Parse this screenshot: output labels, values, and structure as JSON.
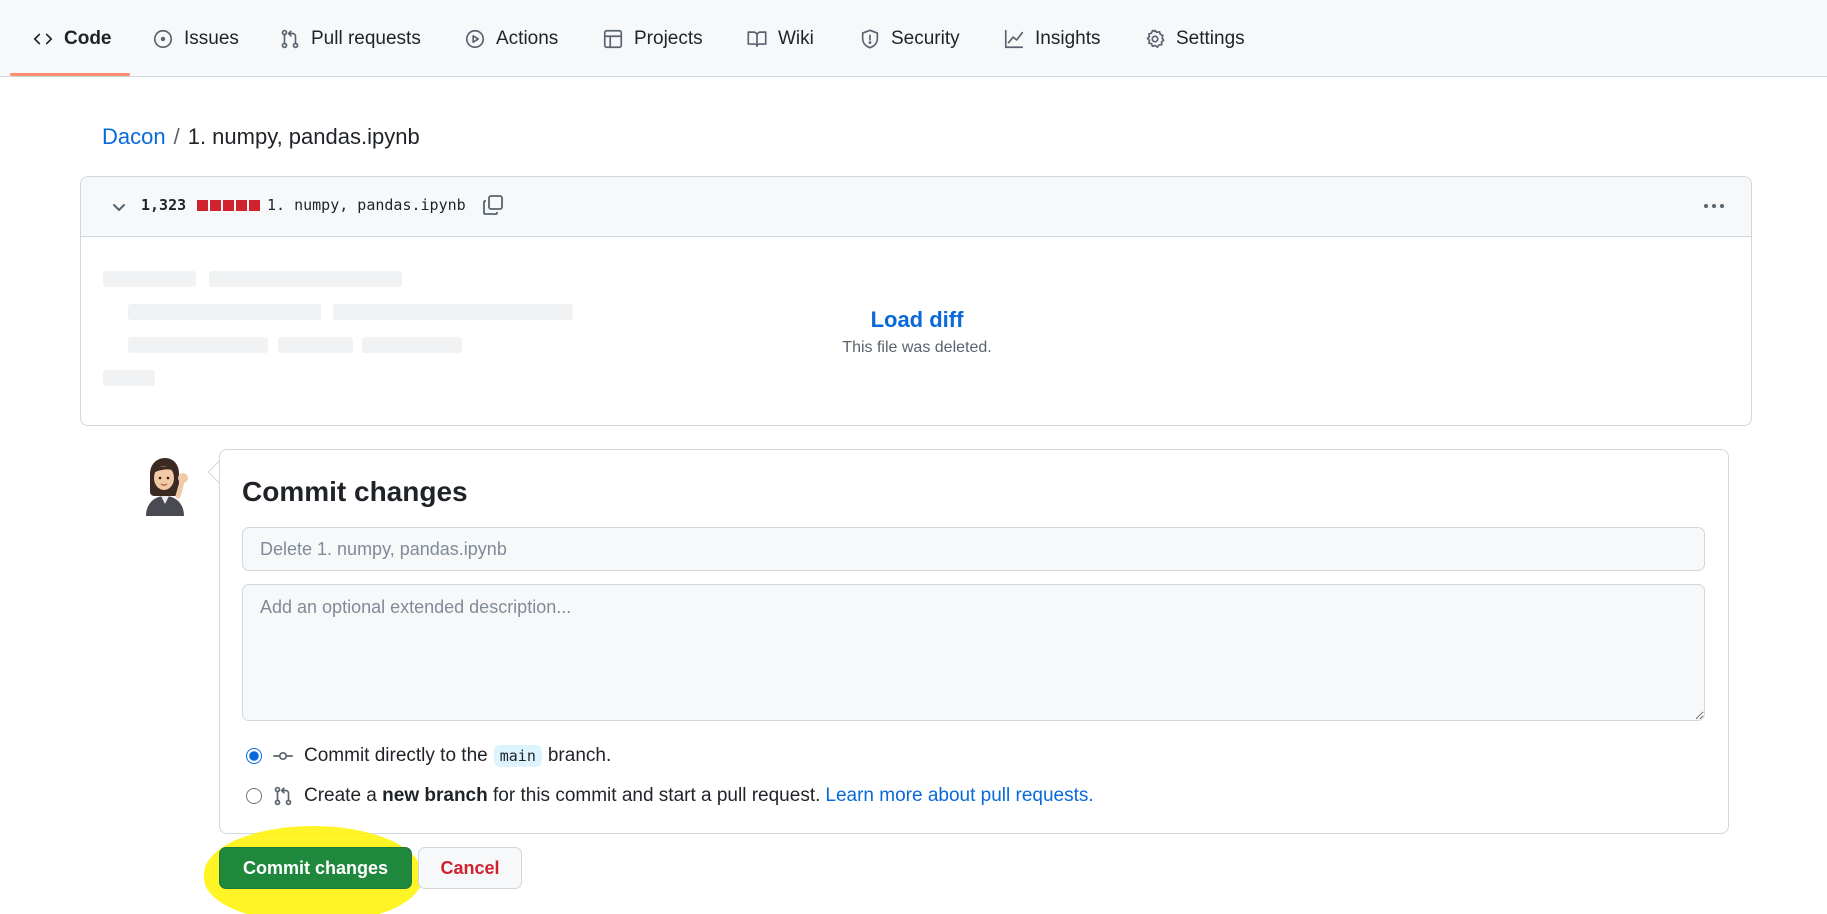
{
  "nav": {
    "tabs": [
      {
        "label": "Code",
        "icon": "code-icon",
        "active": true
      },
      {
        "label": "Issues",
        "icon": "issue-opened-icon"
      },
      {
        "label": "Pull requests",
        "icon": "git-pull-request-icon"
      },
      {
        "label": "Actions",
        "icon": "play-icon"
      },
      {
        "label": "Projects",
        "icon": "table-icon"
      },
      {
        "label": "Wiki",
        "icon": "book-icon"
      },
      {
        "label": "Security",
        "icon": "shield-icon"
      },
      {
        "label": "Insights",
        "icon": "graph-icon"
      },
      {
        "label": "Settings",
        "icon": "gear-icon"
      }
    ]
  },
  "breadcrumb": {
    "repo": "Dacon",
    "separator": "/",
    "file": "1. numpy, pandas.ipynb"
  },
  "diff": {
    "deletions": "1,323",
    "filename": "1. numpy, pandas.ipynb",
    "load_label": "Load diff",
    "status_text": "This file was deleted."
  },
  "commit": {
    "title": "Commit changes",
    "summary_placeholder": "Delete 1. numpy, pandas.ipynb",
    "description_placeholder": "Add an optional extended description...",
    "option_direct": {
      "prefix": "Commit directly to the",
      "branch": "main",
      "suffix": "branch."
    },
    "option_new_branch": {
      "prefix": "Create a",
      "bold": "new branch",
      "suffix": "for this commit and start a pull request.",
      "link": "Learn more about pull requests."
    },
    "submit_label": "Commit changes",
    "cancel_label": "Cancel"
  },
  "colors": {
    "accent": "#0969da",
    "primary_button": "#1f883d",
    "danger": "#cf222e",
    "highlight": "#fff200"
  }
}
